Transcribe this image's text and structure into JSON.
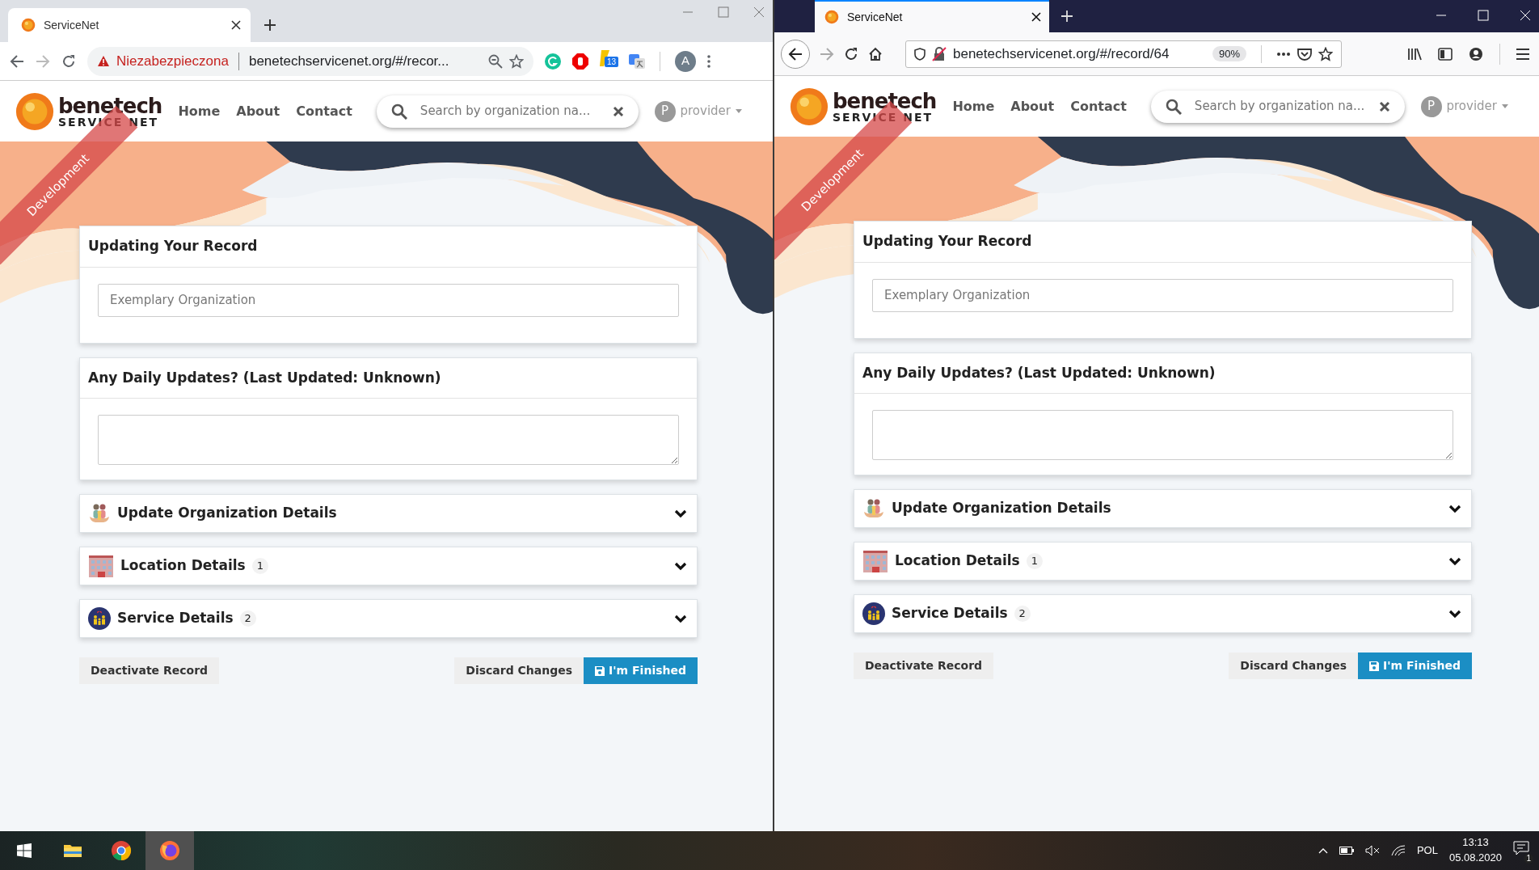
{
  "windows": [
    {
      "kind": "chrome",
      "tab": {
        "title": "ServiceNet"
      },
      "address": {
        "warning": "Niezabezpieczona",
        "url": "benetechservicenet.org/#/recor..."
      },
      "extension_badge": "13",
      "profile_initial": "A",
      "page": {
        "logo": {
          "name": "benetech",
          "tagline": "SERVICE NET"
        },
        "ribbon": "Development",
        "nav": [
          "Home",
          "About",
          "Contact"
        ],
        "search": {
          "placeholder": "Search by organization na..."
        },
        "user": {
          "initial": "P",
          "name": "provider"
        },
        "record_card": {
          "title": "Updating Your Record",
          "placeholder": "Exemplary Organization"
        },
        "updates_card": {
          "title": "Any Daily Updates? (Last Updated: Unknown)"
        },
        "sections": [
          {
            "kind": "family",
            "title": "Update Organization Details"
          },
          {
            "kind": "building",
            "title": "Location Details",
            "count": "1"
          },
          {
            "kind": "people",
            "title": "Service Details",
            "count": "2"
          }
        ],
        "buttons": [
          {
            "kind": "secondary",
            "label": "Deactivate Record"
          },
          {
            "kind": "secondary",
            "label": "Discard Changes"
          },
          {
            "kind": "primary",
            "label": "I'm Finished"
          }
        ]
      }
    },
    {
      "kind": "firefox",
      "tab": {
        "title": "ServiceNet"
      },
      "address": {
        "url": "benetechservicenet.org/#/record/64",
        "zoom": "90%"
      },
      "page": {
        "logo": {
          "name": "benetech",
          "tagline": "SERVICE NET"
        },
        "ribbon": "Development",
        "nav": [
          "Home",
          "About",
          "Contact"
        ],
        "search": {
          "placeholder": "Search by organization na..."
        },
        "user": {
          "initial": "P",
          "name": "provider"
        },
        "record_card": {
          "title": "Updating Your Record",
          "placeholder": "Exemplary Organization"
        },
        "updates_card": {
          "title": "Any Daily Updates? (Last Updated: Unknown)"
        },
        "sections": [
          {
            "kind": "family",
            "title": "Update Organization Details"
          },
          {
            "kind": "building",
            "title": "Location Details",
            "count": "1"
          },
          {
            "kind": "people",
            "title": "Service Details",
            "count": "2"
          }
        ],
        "buttons": [
          {
            "kind": "secondary",
            "label": "Deactivate Record"
          },
          {
            "kind": "secondary",
            "label": "Discard Changes"
          },
          {
            "kind": "primary",
            "label": "I'm Finished"
          }
        ]
      }
    }
  ],
  "taskbar": {
    "apps": [
      {
        "kind": "explorer",
        "selected": false
      },
      {
        "kind": "chrome",
        "selected": false
      },
      {
        "kind": "firefox",
        "selected": true
      }
    ],
    "language": "POL",
    "time": "13:13",
    "date": "05.08.2020",
    "notification_count": "1"
  }
}
